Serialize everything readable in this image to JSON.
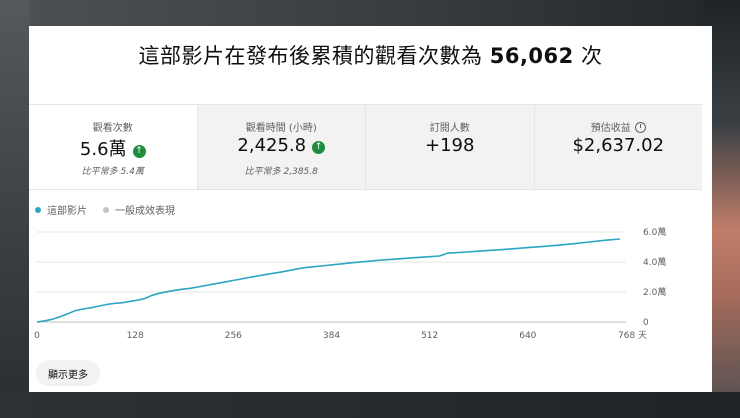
{
  "headline": {
    "prefix": "這部影片在發布後累積的觀看次數為",
    "count": "56,062",
    "suffix": "次"
  },
  "metrics": [
    {
      "label": "觀看次數",
      "value": "5.6萬",
      "sub": "比平常多 5.4萬",
      "trend": "up"
    },
    {
      "label": "觀看時間 (小時)",
      "value": "2,425.8",
      "sub": "比平常多 2,385.8",
      "trend": "up"
    },
    {
      "label": "訂閱人數",
      "value": "+198"
    },
    {
      "label": "預估收益",
      "value": "$2,637.02",
      "icon": "clock-icon"
    }
  ],
  "legend": {
    "this_video": "這部影片",
    "typical": "一般成效表現",
    "this_color": "#2aa5c4",
    "typical_color": "#c4c4c4"
  },
  "chart_data": {
    "type": "line",
    "x_unit": "天",
    "x_ticks": [
      0,
      128,
      256,
      384,
      512,
      640,
      768
    ],
    "x_tick_labels": [
      "0",
      "128",
      "256",
      "384",
      "512",
      "640",
      "768 天"
    ],
    "y_tick_values": [
      0,
      20000,
      40000,
      60000
    ],
    "y_tick_labels": [
      "0",
      "2.0萬",
      "4.0萬",
      "6.0萬"
    ],
    "xlim": [
      0,
      768
    ],
    "ylim": [
      0,
      60000
    ],
    "grid": true,
    "series": [
      {
        "name": "這部影片",
        "color": "#2aa5c4",
        "x": [
          0,
          10,
          20,
          30,
          40,
          50,
          60,
          70,
          80,
          90,
          100,
          110,
          120,
          130,
          140,
          150,
          160,
          170,
          180,
          190,
          200,
          220,
          240,
          260,
          280,
          300,
          320,
          340,
          350,
          370,
          390,
          410,
          430,
          450,
          470,
          490,
          510,
          525,
          535,
          560,
          580,
          600,
          620,
          640,
          660,
          680,
          700,
          720,
          740,
          760
        ],
        "y": [
          0,
          800,
          1800,
          3500,
          5500,
          7600,
          8700,
          9500,
          10600,
          11600,
          12300,
          12800,
          13600,
          14500,
          15600,
          17800,
          19200,
          20200,
          21100,
          21900,
          22500,
          24300,
          26200,
          28100,
          30000,
          31800,
          33500,
          35500,
          36300,
          37300,
          38400,
          39500,
          40400,
          41300,
          42100,
          42800,
          43500,
          44000,
          45900,
          46700,
          47400,
          48100,
          48800,
          49600,
          50400,
          51200,
          52200,
          53300,
          54500,
          55300
        ]
      }
    ]
  },
  "buttons": {
    "show_more": "顯示更多"
  }
}
